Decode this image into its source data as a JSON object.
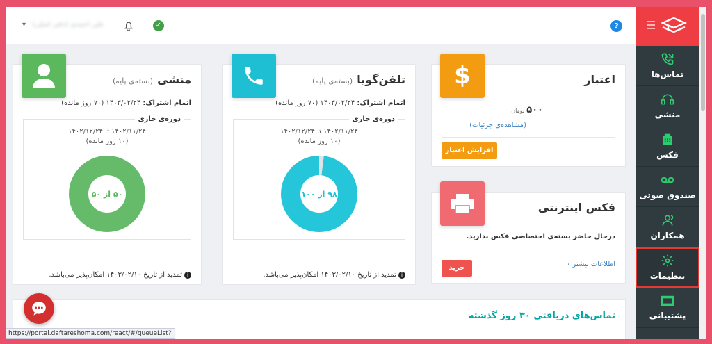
{
  "topbar": {
    "help": "?",
    "user_name": "علی احمدی (دفتر اصلی)"
  },
  "sidebar": {
    "items": [
      {
        "label": "تماس‌ها",
        "icon": "phone-call-icon"
      },
      {
        "label": "منشی",
        "icon": "headset-icon"
      },
      {
        "label": "فکس",
        "icon": "fax-icon"
      },
      {
        "label": "صندوق صوتی",
        "icon": "voicemail-icon"
      },
      {
        "label": "همکاران",
        "icon": "users-icon"
      },
      {
        "label": "تنظیمات",
        "icon": "gear-icon"
      },
      {
        "label": "پشتیبانی",
        "icon": "support-icon"
      }
    ]
  },
  "credit": {
    "title": "اعتبار",
    "amount": "۵۰۰",
    "unit": "تومان",
    "details_link": "(مشاهده‌ی جزئیات)",
    "button": "افزایش اعتبار",
    "color": "#f39c12"
  },
  "phone": {
    "title": "تلفن‌گویا",
    "subtitle": "(بسته‌ی پایه)",
    "expiry_label": "اتمام اشتراک:",
    "expiry_value": "۱۴۰۳/۰۲/۲۴ (۷۰ روز مانده)",
    "period_title": "دوره‌ی جاری",
    "period_dates": "۱۴۰۲/۱۱/۲۴   تا   ۱۴۰۲/۱۲/۲۴",
    "period_left": "(۱۰ روز مانده)",
    "usage_label": "۹۸ از ۱۰۰",
    "used": 98,
    "total": 100,
    "color": "#26c6da",
    "renewal": "تمدید از تاریخ ۱۴۰۳/۰۲/۱۰ امکان‌پذیر می‌باشد."
  },
  "secretary": {
    "title": "منشی",
    "subtitle": "(بسته‌ی پایه)",
    "expiry_label": "اتمام اشتراک:",
    "expiry_value": "۱۴۰۳/۰۲/۲۴ (۷۰ روز مانده)",
    "period_title": "دوره‌ی جاری",
    "period_dates": "۱۴۰۲/۱۱/۲۴   تا   ۱۴۰۲/۱۲/۲۴",
    "period_left": "(۱۰ روز مانده)",
    "usage_label": "۵۰ از ۵۰",
    "used": 50,
    "total": 50,
    "color": "#66bb6a",
    "renewal": "تمدید از تاریخ ۱۴۰۳/۰۲/۱۰ امکان‌پذیر می‌باشد."
  },
  "fax": {
    "title": "فکس اینترنتی",
    "message": "درحال حاضر بسته‌ی اختصاصی فکس ندارید.",
    "more_link": "اطلاعات بیشتر",
    "button": "خرید",
    "color": "#f06a72"
  },
  "calls": {
    "title": "تماس‌های دریافتی ۳۰ روز گذشته"
  },
  "status_url": "https://portal.daftareshoma.com/react/#/queueList?"
}
